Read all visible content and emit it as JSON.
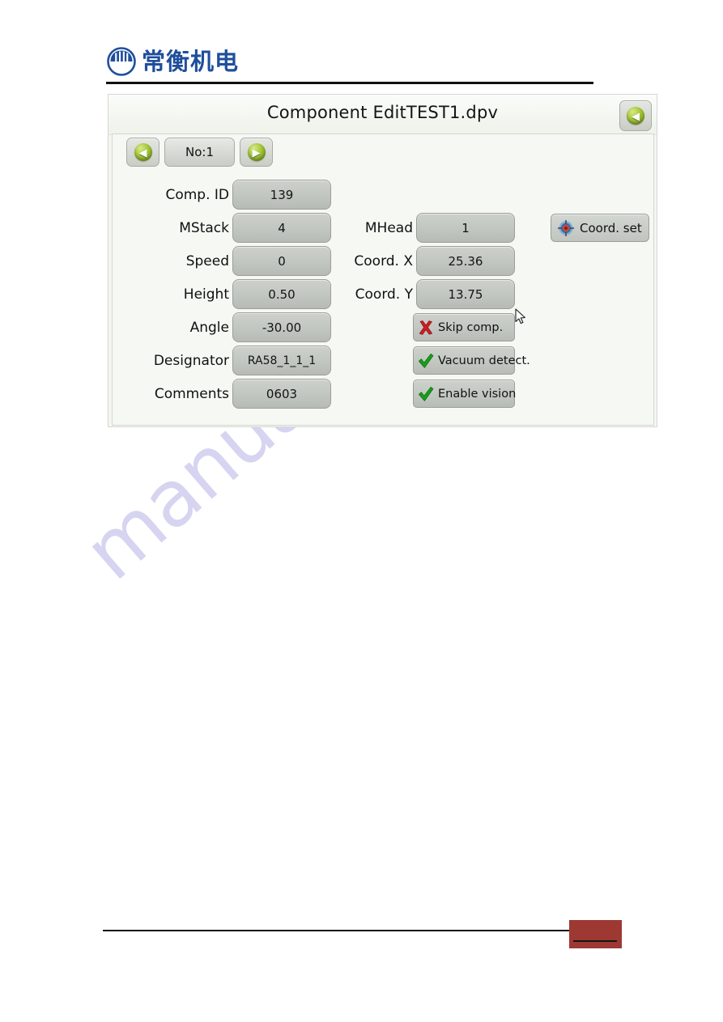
{
  "brand": {
    "logo_text": "常衡机电",
    "logo_icon": "company-emblem-icon",
    "color": "#1f4f9b"
  },
  "watermark": {
    "text": "manualshive.com",
    "color": "#c8c4ec"
  },
  "dialog": {
    "title": "Component EditTEST1.dpv",
    "back_button_icon": "back-arrow-icon",
    "nav": {
      "prev_icon": "left-arrow-icon",
      "next_icon": "right-arrow-icon",
      "index_label": "No:1"
    },
    "left_fields": [
      {
        "label": "Comp. ID",
        "value": "139"
      },
      {
        "label": "MStack",
        "value": "4"
      },
      {
        "label": "Speed",
        "value": "0"
      },
      {
        "label": "Height",
        "value": "0.50"
      },
      {
        "label": "Angle",
        "value": "-30.00"
      },
      {
        "label": "Designator",
        "value": "RA58_1_1_1"
      },
      {
        "label": "Comments",
        "value": "0603"
      }
    ],
    "mid_fields": [
      {
        "label": "MHead",
        "value": "1"
      },
      {
        "label": "Coord. X",
        "value": "25.36"
      },
      {
        "label": "Coord. Y",
        "value": "13.75"
      }
    ],
    "toggles": [
      {
        "label": "Skip comp.",
        "icon": "red-x-icon",
        "state": "off"
      },
      {
        "label": "Vacuum detect.",
        "icon": "green-check-icon",
        "state": "on"
      },
      {
        "label": "Enable vision",
        "icon": "green-check-icon",
        "state": "on"
      }
    ],
    "coord_set": {
      "label": "Coord. set",
      "icon": "crosshair-target-icon"
    }
  },
  "colors": {
    "accent_green": "#a8c93c",
    "check_green": "#18a018",
    "x_red": "#cc1f22",
    "footer_badge": "#9d3832",
    "dialog_bg": "#f4f7f1",
    "field_bg": "#c2c7c1"
  }
}
